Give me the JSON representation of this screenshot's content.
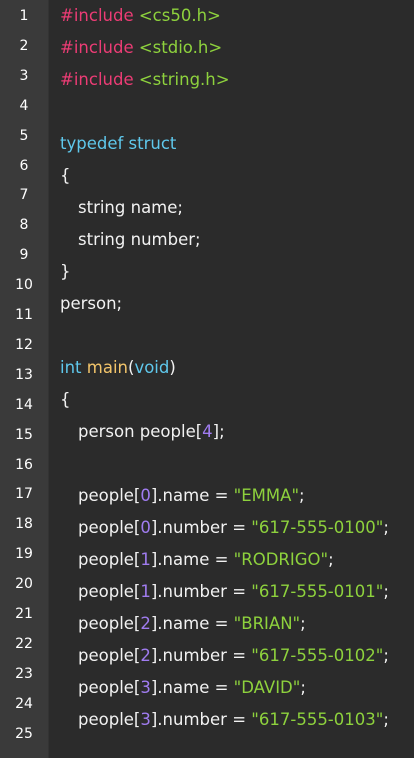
{
  "editor": {
    "colors": {
      "background": "#2b2b2b",
      "gutter": "#3a3a3a",
      "preprocessor": "#ec3c75",
      "keyword": "#5fc8ec",
      "string": "#8ed23d",
      "number": "#a07cf0",
      "function": "#f2c46a",
      "plain": "#f2f2f2"
    },
    "line_numbers": [
      "1",
      "2",
      "3",
      "4",
      "5",
      "6",
      "7",
      "8",
      "9",
      "10",
      "11",
      "12",
      "13",
      "14",
      "15",
      "16",
      "17",
      "18",
      "19",
      "20",
      "21",
      "22",
      "23",
      "24",
      "25"
    ],
    "lines": [
      {
        "indent": false,
        "tokens": [
          {
            "t": "#include",
            "c": "pre"
          },
          {
            "t": " ",
            "c": "id"
          },
          {
            "t": "<cs50.h>",
            "c": "hdr"
          }
        ]
      },
      {
        "indent": false,
        "tokens": [
          {
            "t": "#include",
            "c": "pre"
          },
          {
            "t": " ",
            "c": "id"
          },
          {
            "t": "<stdio.h>",
            "c": "hdr"
          }
        ]
      },
      {
        "indent": false,
        "tokens": [
          {
            "t": "#include",
            "c": "pre"
          },
          {
            "t": " ",
            "c": "id"
          },
          {
            "t": "<string.h>",
            "c": "hdr"
          }
        ]
      },
      {
        "indent": false,
        "tokens": []
      },
      {
        "indent": false,
        "tokens": [
          {
            "t": "typedef struct",
            "c": "kw"
          }
        ]
      },
      {
        "indent": false,
        "tokens": [
          {
            "t": "{",
            "c": "id"
          }
        ]
      },
      {
        "indent": true,
        "tokens": [
          {
            "t": "string name;",
            "c": "id"
          }
        ]
      },
      {
        "indent": true,
        "tokens": [
          {
            "t": "string number;",
            "c": "id"
          }
        ]
      },
      {
        "indent": false,
        "tokens": [
          {
            "t": "}",
            "c": "id"
          }
        ]
      },
      {
        "indent": false,
        "tokens": [
          {
            "t": "person;",
            "c": "id"
          }
        ]
      },
      {
        "indent": false,
        "tokens": []
      },
      {
        "indent": false,
        "tokens": [
          {
            "t": "int",
            "c": "kw"
          },
          {
            "t": " ",
            "c": "id"
          },
          {
            "t": "main",
            "c": "fn"
          },
          {
            "t": "(",
            "c": "id"
          },
          {
            "t": "void",
            "c": "kw"
          },
          {
            "t": ")",
            "c": "id"
          }
        ]
      },
      {
        "indent": false,
        "tokens": [
          {
            "t": "{",
            "c": "id"
          }
        ]
      },
      {
        "indent": true,
        "tokens": [
          {
            "t": "person people[",
            "c": "id"
          },
          {
            "t": "4",
            "c": "num"
          },
          {
            "t": "];",
            "c": "id"
          }
        ]
      },
      {
        "indent": false,
        "tokens": []
      },
      {
        "indent": true,
        "tokens": [
          {
            "t": "people[",
            "c": "id"
          },
          {
            "t": "0",
            "c": "num"
          },
          {
            "t": "].name = ",
            "c": "id"
          },
          {
            "t": "\"EMMA\"",
            "c": "str"
          },
          {
            "t": ";",
            "c": "id"
          }
        ]
      },
      {
        "indent": true,
        "tokens": [
          {
            "t": "people[",
            "c": "id"
          },
          {
            "t": "0",
            "c": "num"
          },
          {
            "t": "].number = ",
            "c": "id"
          },
          {
            "t": "\"617-555-0100\"",
            "c": "str"
          },
          {
            "t": ";",
            "c": "id"
          }
        ]
      },
      {
        "indent": true,
        "tokens": [
          {
            "t": "people[",
            "c": "id"
          },
          {
            "t": "1",
            "c": "num"
          },
          {
            "t": "].name = ",
            "c": "id"
          },
          {
            "t": "\"RODRIGO\"",
            "c": "str"
          },
          {
            "t": ";",
            "c": "id"
          }
        ]
      },
      {
        "indent": true,
        "tokens": [
          {
            "t": "people[",
            "c": "id"
          },
          {
            "t": "1",
            "c": "num"
          },
          {
            "t": "].number = ",
            "c": "id"
          },
          {
            "t": "\"617-555-0101\"",
            "c": "str"
          },
          {
            "t": ";",
            "c": "id"
          }
        ]
      },
      {
        "indent": true,
        "tokens": [
          {
            "t": "people[",
            "c": "id"
          },
          {
            "t": "2",
            "c": "num"
          },
          {
            "t": "].name = ",
            "c": "id"
          },
          {
            "t": "\"BRIAN\"",
            "c": "str"
          },
          {
            "t": ";",
            "c": "id"
          }
        ]
      },
      {
        "indent": true,
        "tokens": [
          {
            "t": "people[",
            "c": "id"
          },
          {
            "t": "2",
            "c": "num"
          },
          {
            "t": "].number = ",
            "c": "id"
          },
          {
            "t": "\"617-555-0102\"",
            "c": "str"
          },
          {
            "t": ";",
            "c": "id"
          }
        ]
      },
      {
        "indent": true,
        "tokens": [
          {
            "t": "people[",
            "c": "id"
          },
          {
            "t": "3",
            "c": "num"
          },
          {
            "t": "].name = ",
            "c": "id"
          },
          {
            "t": "\"DAVID\"",
            "c": "str"
          },
          {
            "t": ";",
            "c": "id"
          }
        ]
      },
      {
        "indent": true,
        "tokens": [
          {
            "t": "people[",
            "c": "id"
          },
          {
            "t": "3",
            "c": "num"
          },
          {
            "t": "].number = ",
            "c": "id"
          },
          {
            "t": "\"617-555-0103\"",
            "c": "str"
          },
          {
            "t": ";",
            "c": "id"
          }
        ]
      }
    ]
  }
}
